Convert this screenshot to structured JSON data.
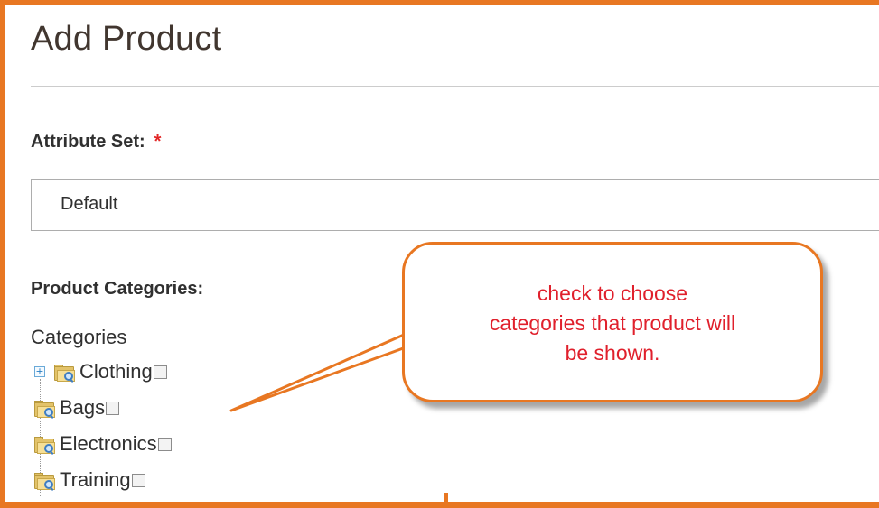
{
  "page": {
    "title": "Add Product"
  },
  "attribute_set": {
    "label": "Attribute Set:",
    "required_mark": "*",
    "selected": "Default"
  },
  "categories": {
    "label": "Product Categories:",
    "tree_root": "Categories",
    "items": [
      {
        "label": "Clothing",
        "expandable": true,
        "checked": false
      },
      {
        "label": "Bags",
        "expandable": false,
        "checked": false
      },
      {
        "label": "Electronics",
        "expandable": false,
        "checked": false
      },
      {
        "label": "Training",
        "expandable": false,
        "checked": false
      }
    ]
  },
  "annotation": {
    "text": "check to choose categories that product will be shown.",
    "lines": [
      "check to choose",
      "categories that product will",
      "be shown."
    ]
  },
  "colors": {
    "accent_orange": "#e87722",
    "annotation_text": "#e0202c",
    "required_star": "#e22626"
  },
  "icons": {
    "expander": "plus-expander-icon",
    "category": "folder-search-icon",
    "checkbox": "checkbox-icon"
  }
}
